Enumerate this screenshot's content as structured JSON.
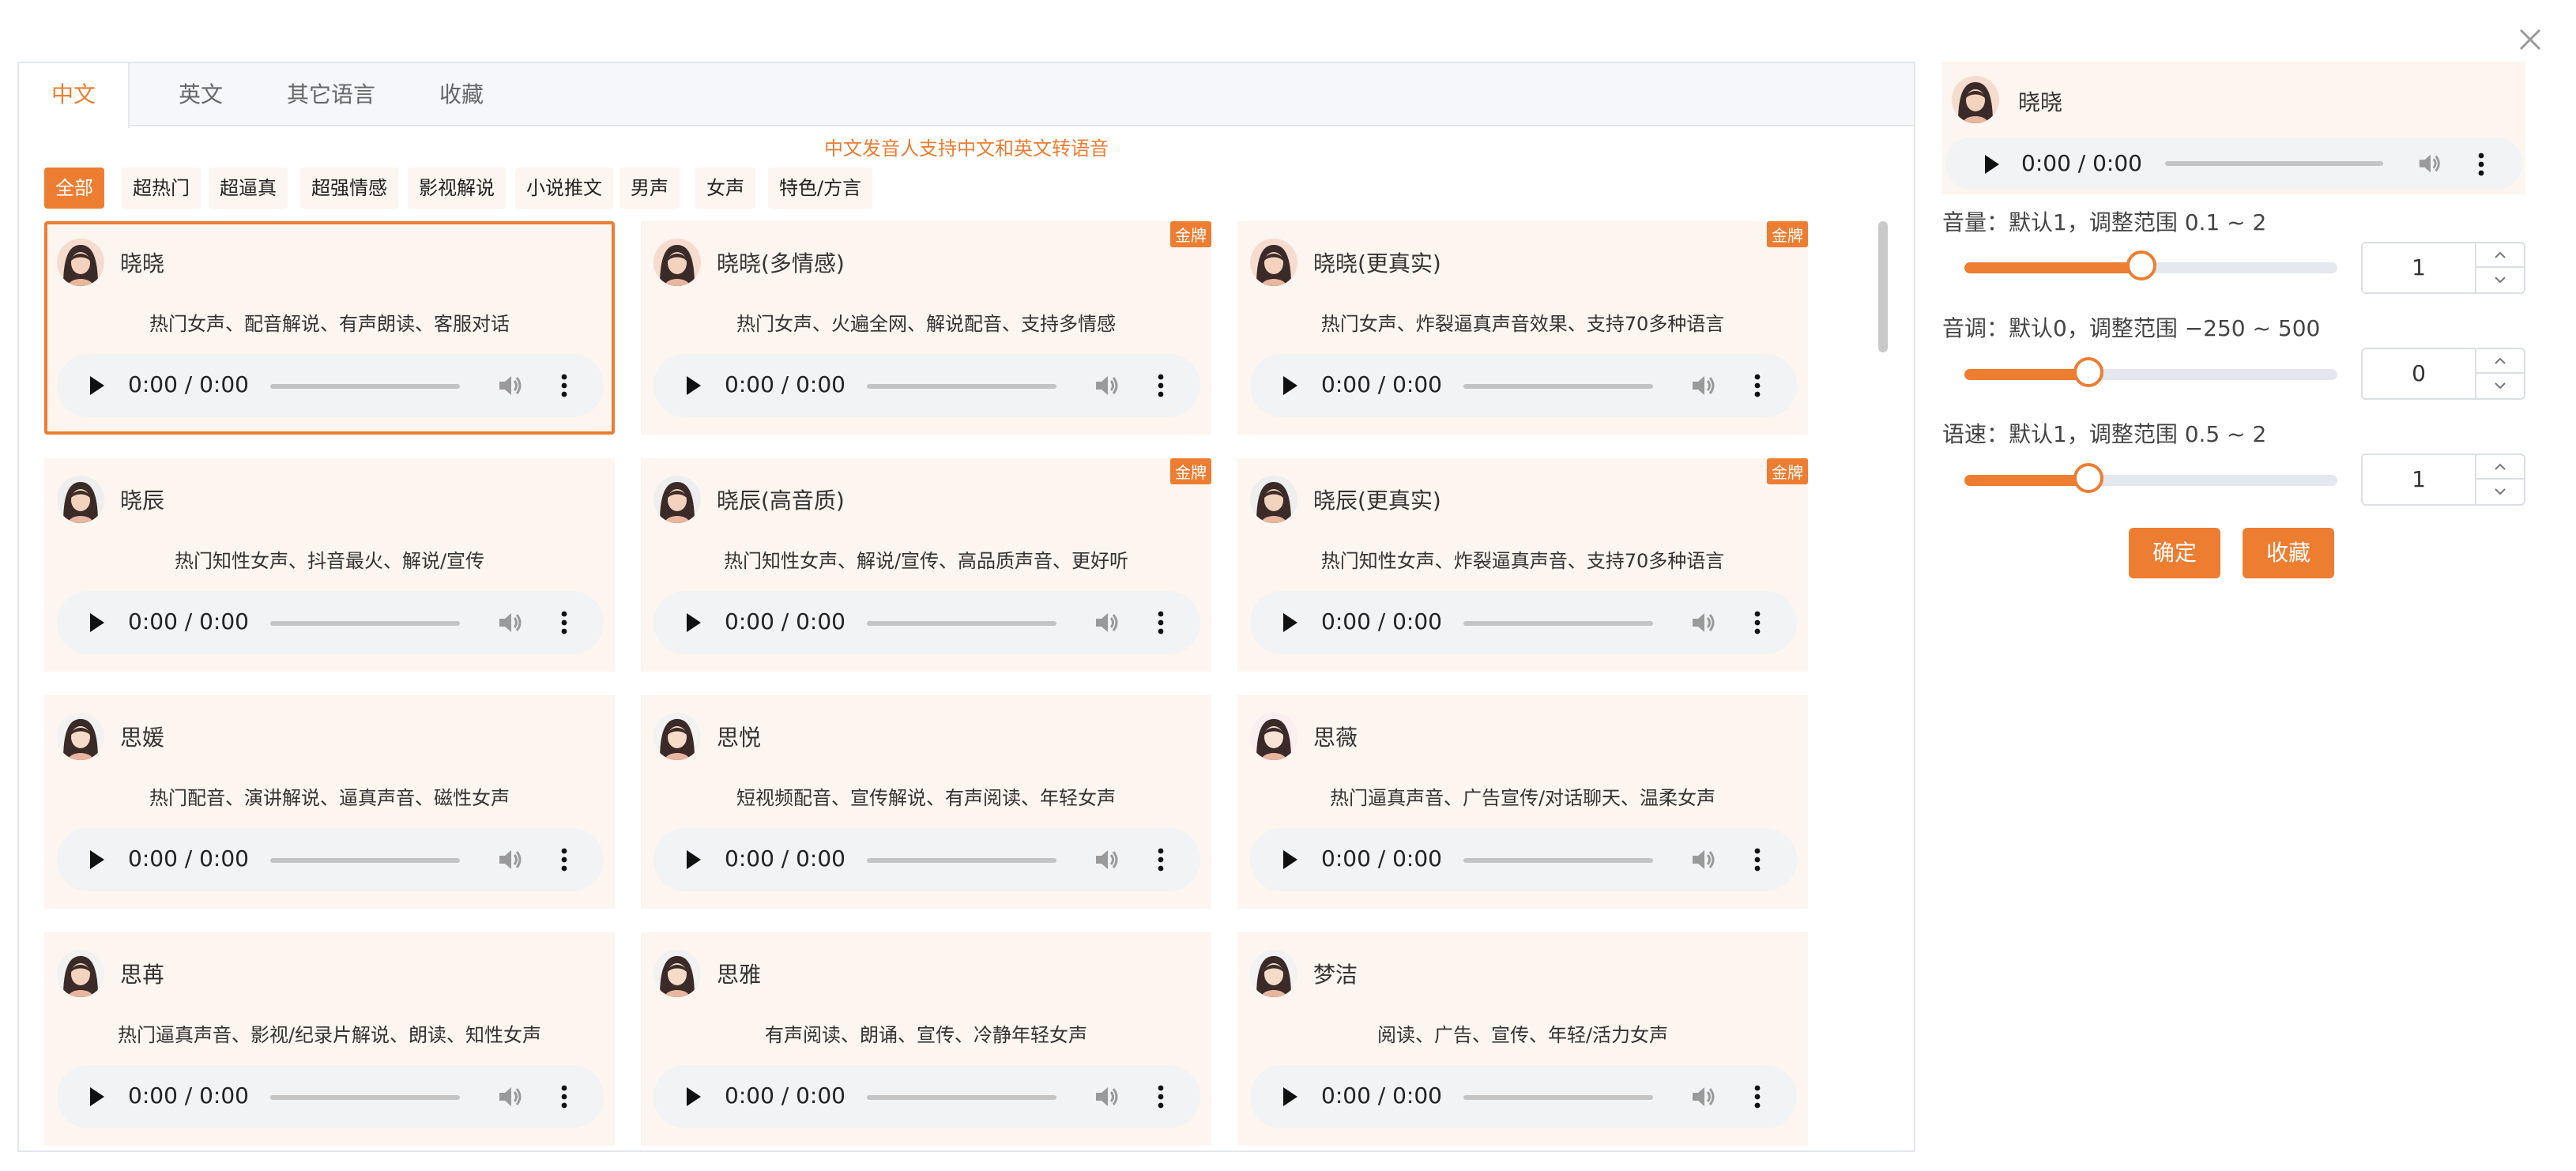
{
  "dialog": {
    "close_icon": "close-icon"
  },
  "tabs": [
    {
      "label": "中文",
      "active": true
    },
    {
      "label": "英文"
    },
    {
      "label": "其它语言"
    },
    {
      "label": "收藏"
    }
  ],
  "notice": "中文发音人支持中文和英文转语音",
  "filters": [
    {
      "label": "全部",
      "active": true
    },
    {
      "label": "超热门"
    },
    {
      "label": "超逼真"
    },
    {
      "label": "超强情感"
    },
    {
      "label": "影视解说"
    },
    {
      "label": "小说推文"
    },
    {
      "label": "男声"
    },
    {
      "label": "女声"
    },
    {
      "label": "特色/方言"
    }
  ],
  "voices": [
    {
      "name": "晓晓",
      "desc": "热门女声、配音解说、有声朗读、客服对话",
      "time": "0:00 / 0:00",
      "badge": "",
      "selected": true
    },
    {
      "name": "晓晓(多情感)",
      "desc": "热门女声、火遍全网、解说配音、支持多情感",
      "time": "0:00 / 0:00",
      "badge": "金牌"
    },
    {
      "name": "晓晓(更真实)",
      "desc": "热门女声、炸裂逼真声音效果、支持70多种语言",
      "time": "0:00 / 0:00",
      "badge": "金牌"
    },
    {
      "name": "晓辰",
      "desc": "热门知性女声、抖音最火、解说/宣传",
      "time": "0:00 / 0:00",
      "badge": ""
    },
    {
      "name": "晓辰(高音质)",
      "desc": "热门知性女声、解说/宣传、高品质声音、更好听",
      "time": "0:00 / 0:00",
      "badge": "金牌"
    },
    {
      "name": "晓辰(更真实)",
      "desc": "热门知性女声、炸裂逼真声音、支持70多种语言",
      "time": "0:00 / 0:00",
      "badge": "金牌"
    },
    {
      "name": "思媛",
      "desc": "热门配音、演讲解说、逼真声音、磁性女声",
      "time": "0:00 / 0:00",
      "badge": ""
    },
    {
      "name": "思悦",
      "desc": "短视频配音、宣传解说、有声阅读、年轻女声",
      "time": "0:00 / 0:00",
      "badge": ""
    },
    {
      "name": "思薇",
      "desc": "热门逼真声音、广告宣传/对话聊天、温柔女声",
      "time": "0:00 / 0:00",
      "badge": ""
    },
    {
      "name": "思苒",
      "desc": "热门逼真声音、影视/纪录片解说、朗读、知性女声",
      "time": "0:00 / 0:00",
      "badge": ""
    },
    {
      "name": "思雅",
      "desc": "有声阅读、朗诵、宣传、冷静年轻女声",
      "time": "0:00 / 0:00",
      "badge": ""
    },
    {
      "name": "梦洁",
      "desc": "阅读、广告、宣传、年轻/活力女声",
      "time": "0:00 / 0:00",
      "badge": ""
    }
  ],
  "selected_voice": {
    "name": "晓晓",
    "time": "0:00 / 0:00"
  },
  "params": {
    "volume": {
      "label": "音量：默认1，调整范围 0.1 ~ 2",
      "value": "1",
      "fraction": 0.475
    },
    "pitch": {
      "label": "音调：默认0，调整范围 −250 ~ 500",
      "value": "0",
      "fraction": 0.333
    },
    "speed": {
      "label": "语速：默认1，调整范围 0.5 ~ 2",
      "value": "1",
      "fraction": 0.333
    }
  },
  "buttons": {
    "confirm": "确定",
    "favorite": "收藏"
  },
  "colors": {
    "accent": "#ed7d31",
    "card_bg": "#fdf5ef",
    "player_bg": "#f1f3f4"
  },
  "icons": {
    "play": "play-icon",
    "volume": "volume-icon",
    "more": "more-vertical-icon",
    "avatar": "avatar-icon",
    "close": "close-icon"
  }
}
